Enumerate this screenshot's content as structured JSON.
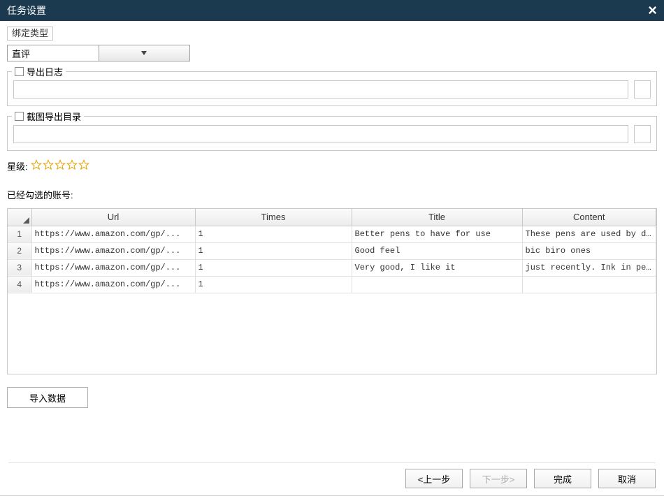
{
  "window": {
    "title": "任务设置"
  },
  "bind_type": {
    "legend": "绑定类型",
    "select_value": "直评"
  },
  "export_log": {
    "legend": "导出日志",
    "path": ""
  },
  "screenshot_dir": {
    "legend": "截图导出目录",
    "path": ""
  },
  "rating": {
    "label": "星级:",
    "stars": 5
  },
  "accounts_label": "已经勾选的账号:",
  "table": {
    "headers": {
      "url": "Url",
      "times": "Times",
      "title": "Title",
      "content": "Content"
    },
    "rows": [
      {
        "n": "1",
        "url": "https://www.amazon.com/gp/...",
        "times": "1",
        "title": " Better pens to have for use",
        "content": "These pens are used by doc..."
      },
      {
        "n": "2",
        "url": "https://www.amazon.com/gp/...",
        "times": "1",
        "title": "Good feel",
        "content": "bic biro ones"
      },
      {
        "n": "3",
        "url": "https://www.amazon.com/gp/...",
        "times": "1",
        "title": "Very good, I like it",
        "content": "just recently. Ink in pens..."
      },
      {
        "n": "4",
        "url": "https://www.amazon.com/gp/...",
        "times": "1",
        "title": "",
        "content": ""
      }
    ]
  },
  "buttons": {
    "import": "导入数据",
    "prev": "<上一步",
    "next": "下一步>",
    "finish": "完成",
    "cancel": "取消"
  }
}
